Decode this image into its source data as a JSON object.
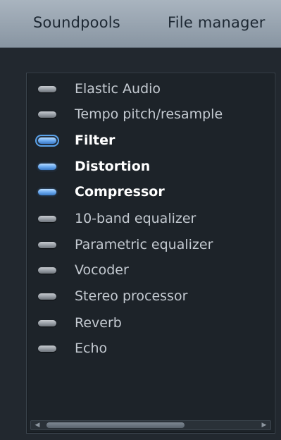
{
  "tabs": [
    {
      "label": "Soundpools"
    },
    {
      "label": "File manager"
    }
  ],
  "effects": [
    {
      "label": "Elastic Audio",
      "enabled": false
    },
    {
      "label": "Tempo pitch/resample",
      "enabled": false
    },
    {
      "label": "Filter",
      "enabled": true,
      "focused": true
    },
    {
      "label": "Distortion",
      "enabled": true
    },
    {
      "label": "Compressor",
      "enabled": true
    },
    {
      "label": "10-band equalizer",
      "enabled": false
    },
    {
      "label": "Parametric equalizer",
      "enabled": false
    },
    {
      "label": "Vocoder",
      "enabled": false
    },
    {
      "label": "Stereo processor",
      "enabled": false
    },
    {
      "label": "Reverb",
      "enabled": false
    },
    {
      "label": "Echo",
      "enabled": false
    }
  ],
  "colors": {
    "led_on": "#6aaaf0",
    "led_off": "#9aa0a7",
    "panel_bg": "#1d2329",
    "tabbar_bg": "#a9b4bf"
  },
  "icons": {
    "scroll_left": "◀",
    "scroll_right": "▶"
  }
}
